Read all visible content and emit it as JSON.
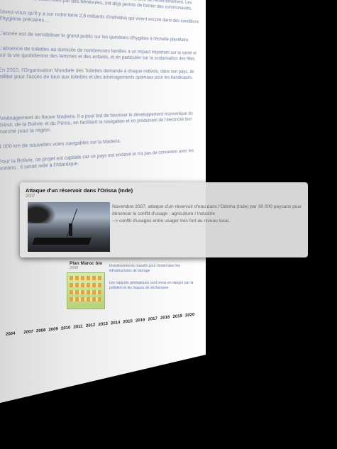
{
  "background_page": {
    "paragraphs": [
      "décharge humaine, un système d'assainissement hygiénique souvent combiné à la mise à disposition d'eau potable et à la gestion des eaux usées pour le bien de l'environnement. Les équipes locales, soutenues par des bénévoles, ont déjà permis de former des communautés.",
      "Savez-vous qu'il y a sur notre terre 2,6 milliards d'individus qui vivent encore dans des conditions d'hygiène précaires…",
      "L'année est de sensibiliser le grand public sur les questions d'hygiène à l'échelle planétaire.",
      "L'absence de toilettes au domicile de nombreuses familles a un impact important sur la santé et sur la vie quotidienne des femmes et des enfants, et en particulier sur la scolarisation des filles.",
      "En 2010, l'Organisation Mondiale des Toilettes demande à chaque individu, dans son pays, de militer pour l'accès de tous aux toilettes et des aménagements optimaux pour les handicapés.",
      "Aménagement du fleuve Madeira. Il a pour but de favoriser le développement économique du Brésil, de la Bolivie et du Pérou, en facilitant la navigation et en produisant de l'électricité bon marché pour la région.",
      "4 000 km de nouvelles voies navigables sur la Madeira.",
      "Pour la Bolivie, ce projet est capitale car ce pays est enclavé et n'a pas de connexion avec les océans ; il serait relié à l'Atlantique."
    ]
  },
  "mini_event": {
    "title": "Plan Maroc bio",
    "year": "2008",
    "lines": [
      "Investissements massifs pour moderniser les infrastructures de barrage",
      "Les rapports géologiques sont revus en danger par la pollution et les risques de sécheresse"
    ]
  },
  "timeline": {
    "years": [
      "2004",
      "2007",
      "2008",
      "2009",
      "2010",
      "2011",
      "2012",
      "2013",
      "2014",
      "2015",
      "2016",
      "2017",
      "2018",
      "2019",
      "2020"
    ]
  },
  "modal": {
    "title": "Attaque d'un réservoir dans l'Orissa (Inde)",
    "year": "2007",
    "line1": "Novembre 2007, attaque d'un réservoir d'eau dans l'Odisha (Inde) par 30 000 paysans pour",
    "line2": "dénoncer le conflit d'usage : agriculture / industrie",
    "line3": "--> conflit d'usages entre usager très fort au niveau local."
  }
}
